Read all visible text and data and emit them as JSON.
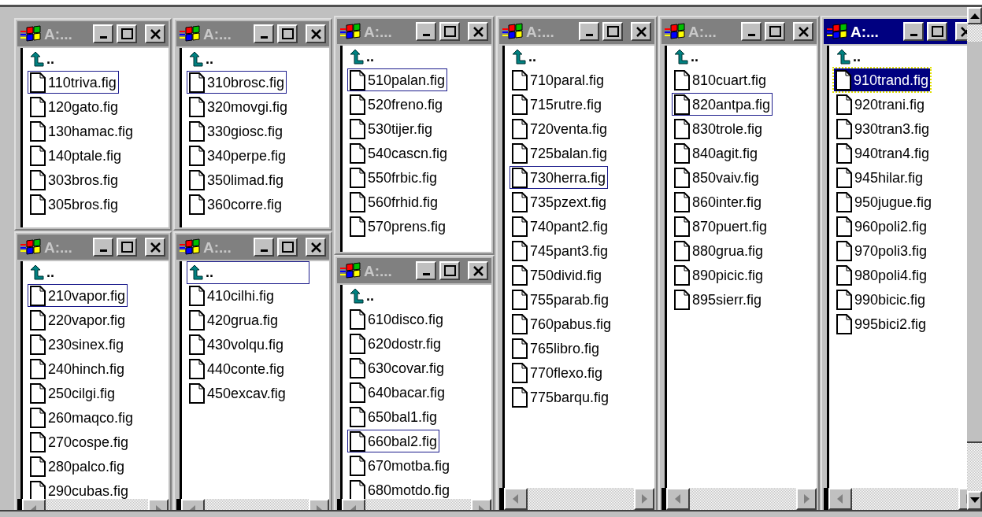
{
  "windows": [
    {
      "title": "A:...",
      "active": false,
      "items": [
        {
          "kind": "parent",
          "label": "..",
          "selected": false
        },
        {
          "kind": "file",
          "label": "110triva.fig",
          "selected": true
        },
        {
          "kind": "file",
          "label": "120gato.fig",
          "selected": false
        },
        {
          "kind": "file",
          "label": "130hamac.fig",
          "selected": false
        },
        {
          "kind": "file",
          "label": "140ptale.fig",
          "selected": false
        },
        {
          "kind": "file",
          "label": "303bros.fig",
          "selected": false
        },
        {
          "kind": "file",
          "label": "305bros.fig",
          "selected": false
        }
      ]
    },
    {
      "title": "A:...",
      "active": false,
      "items": [
        {
          "kind": "parent",
          "label": "..",
          "selected": false
        },
        {
          "kind": "file",
          "label": "310brosc.fig",
          "selected": true
        },
        {
          "kind": "file",
          "label": "320movgi.fig",
          "selected": false
        },
        {
          "kind": "file",
          "label": "330giosc.fig",
          "selected": false
        },
        {
          "kind": "file",
          "label": "340perpe.fig",
          "selected": false
        },
        {
          "kind": "file",
          "label": "350limad.fig",
          "selected": false
        },
        {
          "kind": "file",
          "label": "360corre.fig",
          "selected": false
        }
      ]
    },
    {
      "title": "A:...",
      "active": false,
      "items": [
        {
          "kind": "parent",
          "label": "..",
          "selected": false
        },
        {
          "kind": "file",
          "label": "510palan.fig",
          "selected": true
        },
        {
          "kind": "file",
          "label": "520freno.fig",
          "selected": false
        },
        {
          "kind": "file",
          "label": "530tijer.fig",
          "selected": false
        },
        {
          "kind": "file",
          "label": "540cascn.fig",
          "selected": false
        },
        {
          "kind": "file",
          "label": "550frbic.fig",
          "selected": false
        },
        {
          "kind": "file",
          "label": "560frhid.fig",
          "selected": false
        },
        {
          "kind": "file",
          "label": "570prens.fig",
          "selected": false
        }
      ]
    },
    {
      "title": "A:...",
      "active": false,
      "items": [
        {
          "kind": "parent",
          "label": "..",
          "selected": false
        },
        {
          "kind": "file",
          "label": "710paral.fig",
          "selected": false
        },
        {
          "kind": "file",
          "label": "715rutre.fig",
          "selected": false
        },
        {
          "kind": "file",
          "label": "720venta.fig",
          "selected": false
        },
        {
          "kind": "file",
          "label": "725balan.fig",
          "selected": false
        },
        {
          "kind": "file",
          "label": "730herra.fig",
          "selected": true
        },
        {
          "kind": "file",
          "label": "735pzext.fig",
          "selected": false
        },
        {
          "kind": "file",
          "label": "740pant2.fig",
          "selected": false
        },
        {
          "kind": "file",
          "label": "745pant3.fig",
          "selected": false
        },
        {
          "kind": "file",
          "label": "750divid.fig",
          "selected": false
        },
        {
          "kind": "file",
          "label": "755parab.fig",
          "selected": false
        },
        {
          "kind": "file",
          "label": "760pabus.fig",
          "selected": false
        },
        {
          "kind": "file",
          "label": "765libro.fig",
          "selected": false
        },
        {
          "kind": "file",
          "label": "770flexo.fig",
          "selected": false
        },
        {
          "kind": "file",
          "label": "775barqu.fig",
          "selected": false
        }
      ]
    },
    {
      "title": "A:...",
      "active": false,
      "items": [
        {
          "kind": "parent",
          "label": "..",
          "selected": false
        },
        {
          "kind": "file",
          "label": "810cuart.fig",
          "selected": false
        },
        {
          "kind": "file",
          "label": "820antpa.fig",
          "selected": true
        },
        {
          "kind": "file",
          "label": "830trole.fig",
          "selected": false
        },
        {
          "kind": "file",
          "label": "840agit.fig",
          "selected": false
        },
        {
          "kind": "file",
          "label": "850vaiv.fig",
          "selected": false
        },
        {
          "kind": "file",
          "label": "860inter.fig",
          "selected": false
        },
        {
          "kind": "file",
          "label": "870puert.fig",
          "selected": false
        },
        {
          "kind": "file",
          "label": "880grua.fig",
          "selected": false
        },
        {
          "kind": "file",
          "label": "890picic.fig",
          "selected": false
        },
        {
          "kind": "file",
          "label": "895sierr.fig",
          "selected": false
        }
      ]
    },
    {
      "title": "A:...",
      "active": true,
      "items": [
        {
          "kind": "parent",
          "label": "..",
          "selected": false
        },
        {
          "kind": "file",
          "label": "910trand.fig",
          "selected": true
        },
        {
          "kind": "file",
          "label": "920trani.fig",
          "selected": false
        },
        {
          "kind": "file",
          "label": "930tran3.fig",
          "selected": false
        },
        {
          "kind": "file",
          "label": "940tran4.fig",
          "selected": false
        },
        {
          "kind": "file",
          "label": "945hilar.fig",
          "selected": false
        },
        {
          "kind": "file",
          "label": "950jugue.fig",
          "selected": false
        },
        {
          "kind": "file",
          "label": "960poli2.fig",
          "selected": false
        },
        {
          "kind": "file",
          "label": "970poli3.fig",
          "selected": false
        },
        {
          "kind": "file",
          "label": "980poli4.fig",
          "selected": false
        },
        {
          "kind": "file",
          "label": "990bicic.fig",
          "selected": false
        },
        {
          "kind": "file",
          "label": "995bici2.fig",
          "selected": false
        }
      ]
    },
    {
      "title": "A:...",
      "active": false,
      "items": [
        {
          "kind": "parent",
          "label": "..",
          "selected": false
        },
        {
          "kind": "file",
          "label": "210vapor.fig",
          "selected": true
        },
        {
          "kind": "file",
          "label": "220vapor.fig",
          "selected": false
        },
        {
          "kind": "file",
          "label": "230sinex.fig",
          "selected": false
        },
        {
          "kind": "file",
          "label": "240hinch.fig",
          "selected": false
        },
        {
          "kind": "file",
          "label": "250cilgi.fig",
          "selected": false
        },
        {
          "kind": "file",
          "label": "260maqco.fig",
          "selected": false
        },
        {
          "kind": "file",
          "label": "270cospe.fig",
          "selected": false
        },
        {
          "kind": "file",
          "label": "280palco.fig",
          "selected": false
        },
        {
          "kind": "file",
          "label": "290cubas.fig",
          "selected": false
        }
      ]
    },
    {
      "title": "A:...",
      "active": false,
      "items": [
        {
          "kind": "parent",
          "label": "..",
          "selected": true
        },
        {
          "kind": "file",
          "label": "410cilhi.fig",
          "selected": false
        },
        {
          "kind": "file",
          "label": "420grua.fig",
          "selected": false
        },
        {
          "kind": "file",
          "label": "430volqu.fig",
          "selected": false
        },
        {
          "kind": "file",
          "label": "440conte.fig",
          "selected": false
        },
        {
          "kind": "file",
          "label": "450excav.fig",
          "selected": false
        }
      ]
    },
    {
      "title": "A:...",
      "active": false,
      "items": [
        {
          "kind": "parent",
          "label": "..",
          "selected": false
        },
        {
          "kind": "file",
          "label": "610disco.fig",
          "selected": false
        },
        {
          "kind": "file",
          "label": "620dostr.fig",
          "selected": false
        },
        {
          "kind": "file",
          "label": "630covar.fig",
          "selected": false
        },
        {
          "kind": "file",
          "label": "640bacar.fig",
          "selected": false
        },
        {
          "kind": "file",
          "label": "650bal1.fig",
          "selected": false
        },
        {
          "kind": "file",
          "label": "660bal2.fig",
          "selected": true
        },
        {
          "kind": "file",
          "label": "670motba.fig",
          "selected": false
        },
        {
          "kind": "file",
          "label": "680motdo.fig",
          "selected": false
        }
      ]
    }
  ]
}
